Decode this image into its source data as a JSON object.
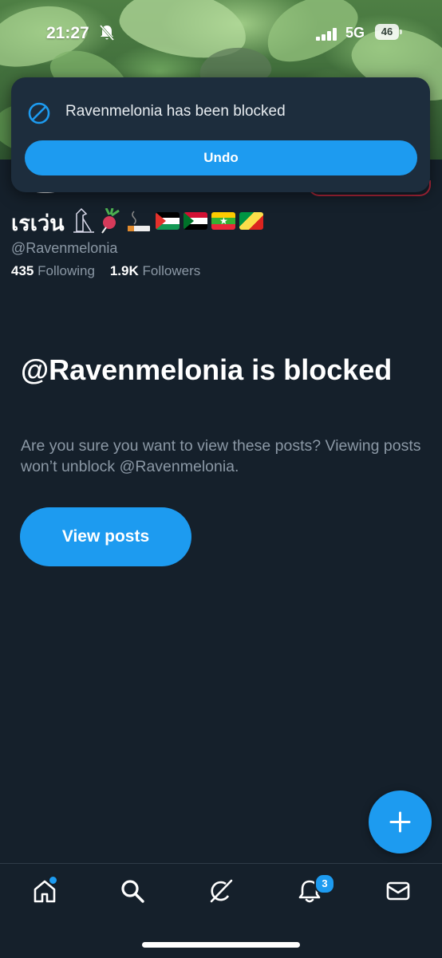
{
  "status_bar": {
    "time": "21:27",
    "network": "5G",
    "battery": "46",
    "icons": [
      "bell-slash-icon",
      "signal-icon",
      "battery-icon"
    ]
  },
  "toast": {
    "message": "Ravenmelonia has been blocked",
    "undo_label": "Undo",
    "icon": "block-icon"
  },
  "profile": {
    "display_name": "เรเว่น",
    "name_emojis": [
      "pharaoh-glyph-icon",
      "radish-icon",
      "cigarette-icon",
      "flag-palestine",
      "flag-sudan",
      "flag-myanmar",
      "flag-congo"
    ],
    "handle": "@Ravenmelonia",
    "following_count": "435",
    "following_label": "Following",
    "followers_count": "1.9K",
    "followers_label": "Followers"
  },
  "blocked_notice": {
    "title": "@Ravenmelonia is blocked",
    "subtitle": "Are you sure you want to view these posts? Viewing posts won’t unblock @Ravenmelonia.",
    "button_label": "View posts"
  },
  "fab": {
    "icon": "plus-icon"
  },
  "tabbar": {
    "items": [
      {
        "name": "home",
        "icon": "home-icon"
      },
      {
        "name": "search",
        "icon": "search-icon"
      },
      {
        "name": "grok",
        "icon": "grok-icon"
      },
      {
        "name": "notifications",
        "icon": "bell-icon",
        "badge": "3"
      },
      {
        "name": "messages",
        "icon": "mail-icon"
      }
    ]
  },
  "colors": {
    "background": "#15202b",
    "accent": "#1d9bf0",
    "muted_text": "#8b98a5",
    "toast_bg": "#1d2d3d"
  }
}
